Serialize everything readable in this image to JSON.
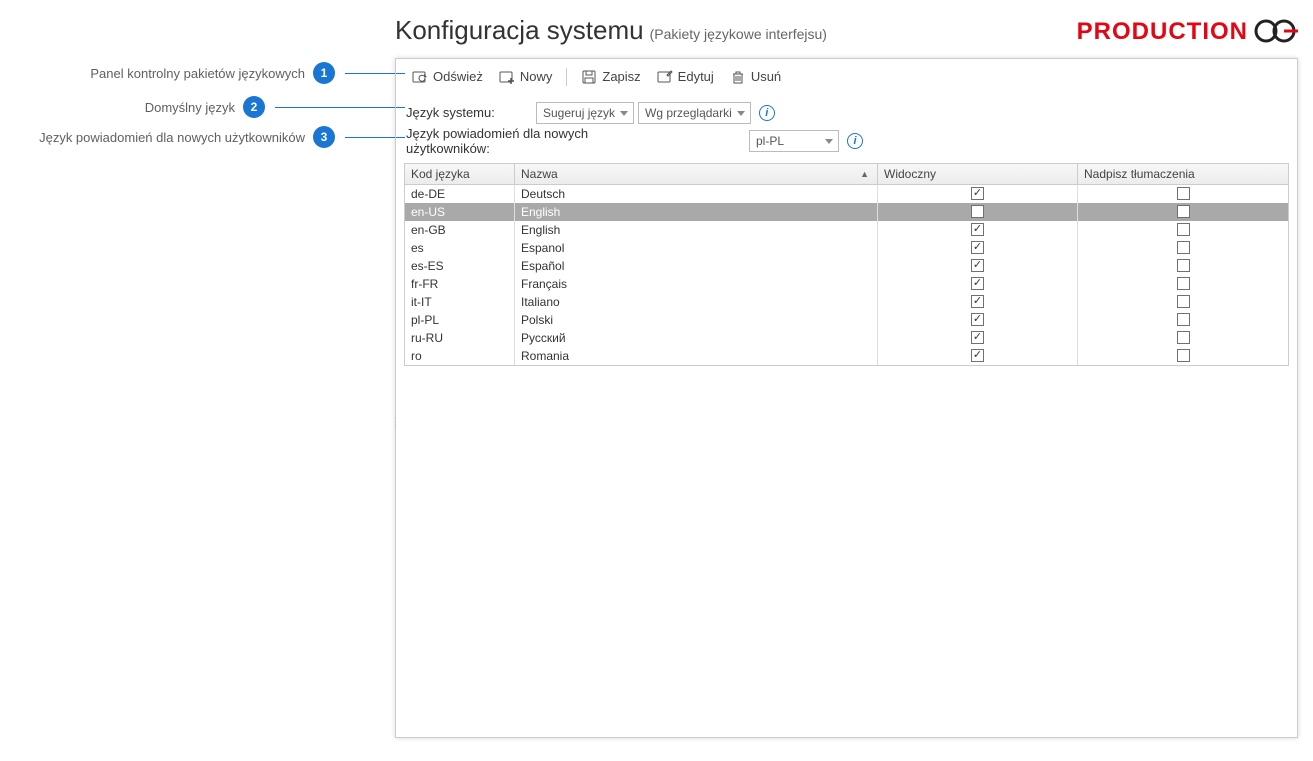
{
  "header": {
    "title": "Konfiguracja systemu",
    "subtitle": "(Pakiety językowe interfejsu)",
    "brand": "PRODUCTION"
  },
  "callouts": [
    {
      "num": "1",
      "label": "Panel kontrolny pakietów językowych"
    },
    {
      "num": "2",
      "label": "Domyślny język"
    },
    {
      "num": "3",
      "label": "Język powiadomień dla nowych użytkowników"
    }
  ],
  "toolbar": {
    "refresh": "Odśwież",
    "new": "Nowy",
    "save": "Zapisz",
    "edit": "Edytuj",
    "delete": "Usuń"
  },
  "settings": {
    "systemLangLabel": "Język systemu:",
    "systemLangSelect1": "Sugeruj język",
    "systemLangSelect2": "Wg przeglądarki",
    "notifLabel": "Język powiadomień dla nowych użytkowników:",
    "notifSelect": "pl-PL"
  },
  "grid": {
    "headers": {
      "code": "Kod języka",
      "name": "Nazwa",
      "visible": "Widoczny",
      "overwrite": "Nadpisz tłumaczenia"
    },
    "rows": [
      {
        "code": "de-DE",
        "name": "Deutsch",
        "visible": true,
        "overwrite": false,
        "selected": false
      },
      {
        "code": "en-US",
        "name": "English",
        "visible": false,
        "overwrite": false,
        "selected": true
      },
      {
        "code": "en-GB",
        "name": "English",
        "visible": true,
        "overwrite": false,
        "selected": false
      },
      {
        "code": "es",
        "name": "Espanol",
        "visible": true,
        "overwrite": false,
        "selected": false
      },
      {
        "code": "es-ES",
        "name": "Español",
        "visible": true,
        "overwrite": false,
        "selected": false
      },
      {
        "code": "fr-FR",
        "name": "Français",
        "visible": true,
        "overwrite": false,
        "selected": false
      },
      {
        "code": "it-IT",
        "name": "Italiano",
        "visible": true,
        "overwrite": false,
        "selected": false
      },
      {
        "code": "pl-PL",
        "name": "Polski",
        "visible": true,
        "overwrite": false,
        "selected": false
      },
      {
        "code": "ru-RU",
        "name": "Русский",
        "visible": true,
        "overwrite": false,
        "selected": false
      },
      {
        "code": "ro",
        "name": "Romania",
        "visible": true,
        "overwrite": false,
        "selected": false
      }
    ]
  }
}
